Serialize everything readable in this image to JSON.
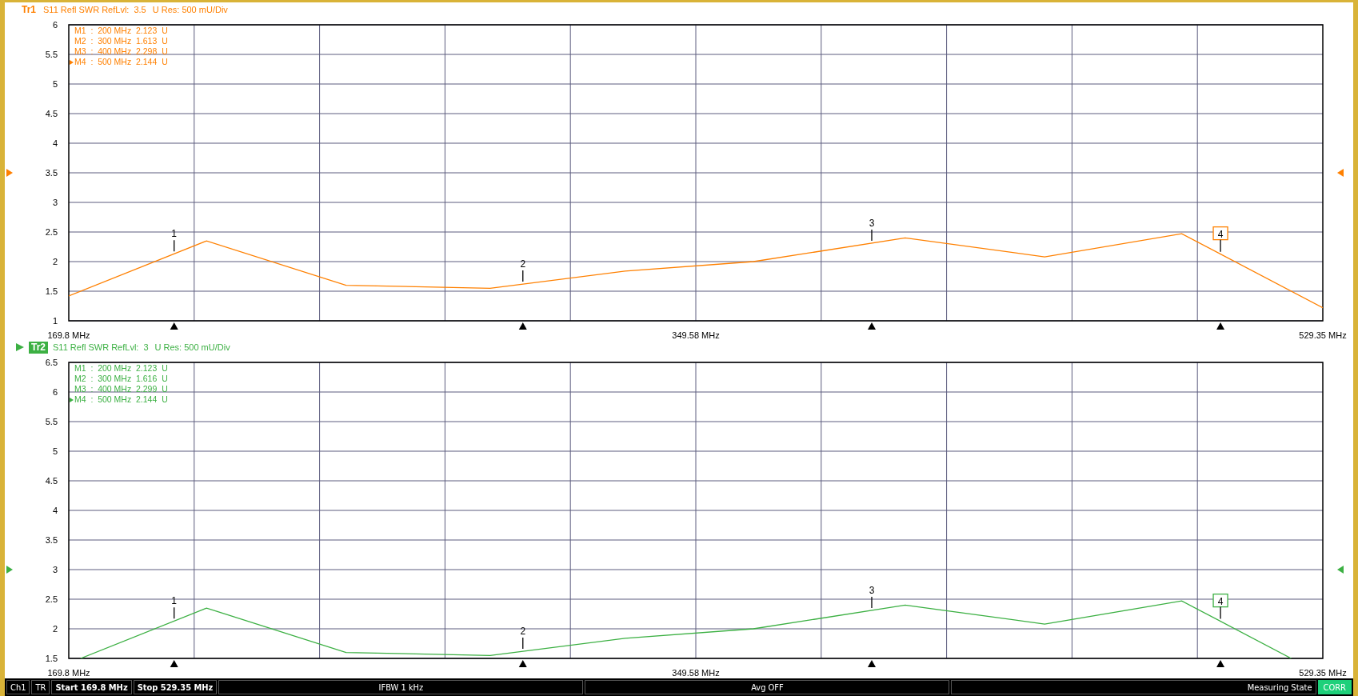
{
  "traces": [
    {
      "active": false,
      "color": "#ff8000",
      "measurement": "S11 Refl SWR RefLvl:",
      "ref_level": "3.5",
      "resolution": "U Res: 500 mU/Div",
      "marker_table": [
        {
          "text": "M1  :  200 MHz  2.123  U",
          "selected": false
        },
        {
          "text": "M2  :  300 MHz  1.613  U",
          "selected": false
        },
        {
          "text": "M3  :  400 MHz  2.298  U",
          "selected": false
        },
        {
          "text": "M4  :  500 MHz  2.144  U",
          "selected": true
        }
      ],
      "markers": [
        {
          "label": "1",
          "level": 0.084,
          "selected": false
        },
        {
          "label": "2",
          "level": 0.3621,
          "selected": false
        },
        {
          "label": "3",
          "level": 0.6403,
          "selected": false
        },
        {
          "label": "4",
          "level": 0.9184,
          "selected": true
        }
      ],
      "chart_data": {
        "type": "line",
        "x": [
          169.8,
          209.3,
          249.3,
          290.6,
          329.3,
          366.1,
          409.6,
          449.6,
          488.9,
          529.35
        ],
        "series": [
          {
            "name": "Tr1",
            "color": "#ff8000",
            "values": [
              1.42,
              2.35,
              1.6,
              1.55,
              1.84,
              2.0,
              2.4,
              2.08,
              2.47,
              1.22
            ]
          }
        ],
        "xlim": [
          169.8,
          529.35
        ],
        "ylim": [
          1,
          6
        ],
        "grid": true,
        "xticks": [
          {
            "value": 169.8,
            "label": "169.8 MHz"
          },
          {
            "value": 349.58,
            "label": "349.58 MHz"
          },
          {
            "value": 529.35,
            "label": "529.35 MHz"
          }
        ],
        "yticks": [
          1,
          1.5,
          2,
          2.5,
          3,
          3.5,
          4,
          4.5,
          5,
          5.5,
          6
        ]
      }
    },
    {
      "active": true,
      "color": "#3cb043",
      "measurement": "S11 Refl SWR RefLvl:",
      "ref_level": "3",
      "resolution": "U Res: 500 mU/Div",
      "marker_table": [
        {
          "text": "M1  :  200 MHz  2.123  U",
          "selected": false
        },
        {
          "text": "M2  :  300 MHz  1.616  U",
          "selected": false
        },
        {
          "text": "M3  :  400 MHz  2.299  U",
          "selected": false
        },
        {
          "text": "M4  :  500 MHz  2.144  U",
          "selected": true
        }
      ],
      "markers": [
        {
          "label": "1",
          "level": 0.084,
          "selected": false
        },
        {
          "label": "2",
          "level": 0.3621,
          "selected": false
        },
        {
          "label": "3",
          "level": 0.6403,
          "selected": false
        },
        {
          "label": "4",
          "level": 0.9184,
          "selected": true
        }
      ],
      "chart_data": {
        "type": "line",
        "x": [
          173.2,
          209.3,
          249.3,
          290.6,
          329.3,
          366.1,
          409.6,
          449.6,
          488.9,
          520.3
        ],
        "series": [
          {
            "name": "Tr2",
            "color": "#3cb043",
            "values": [
              1.5,
              2.35,
              1.6,
              1.55,
              1.84,
              2.0,
              2.4,
              2.08,
              2.47,
              1.5
            ]
          }
        ],
        "xlim": [
          169.8,
          529.35
        ],
        "ylim": [
          1.5,
          6.5
        ],
        "grid": true,
        "xticks": [
          {
            "value": 169.8,
            "label": "169.8 MHz"
          },
          {
            "value": 349.58,
            "label": "349.58 MHz"
          },
          {
            "value": 529.35,
            "label": "529.35 MHz"
          }
        ],
        "yticks": [
          1.5,
          2,
          2.5,
          3,
          3.5,
          4,
          4.5,
          5,
          5.5,
          6,
          6.5
        ]
      }
    }
  ],
  "status_bar": [
    {
      "kind": "cell",
      "text": "Ch1"
    },
    {
      "kind": "cell",
      "text": "TR"
    },
    {
      "kind": "bold",
      "text": "Start 169.8 MHz"
    },
    {
      "kind": "bold",
      "text": "Stop 529.35 MHz"
    },
    {
      "kind": "wide",
      "text": "IFBW 1 kHz"
    },
    {
      "kind": "wide",
      "text": "Avg OFF"
    },
    {
      "kind": "right",
      "text": "Measuring State"
    },
    {
      "kind": "badge",
      "text": "CORR"
    }
  ]
}
